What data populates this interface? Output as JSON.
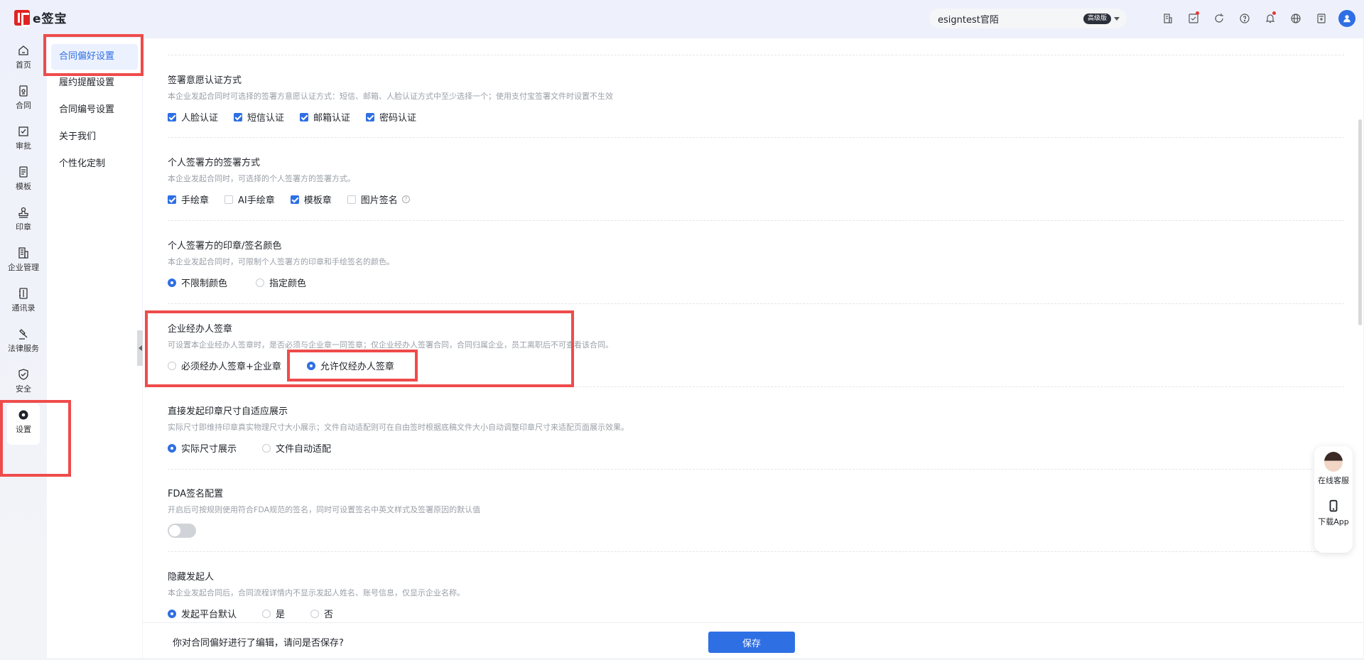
{
  "app": {
    "logo_text": "e签宝",
    "org_name": "esigntest官陌",
    "plan_badge": "高级版"
  },
  "leftnav": [
    {
      "label": "首页",
      "icon": "home-icon"
    },
    {
      "label": "合同",
      "icon": "contract-icon"
    },
    {
      "label": "审批",
      "icon": "approval-icon"
    },
    {
      "label": "模板",
      "icon": "template-icon"
    },
    {
      "label": "印章",
      "icon": "seal-icon"
    },
    {
      "label": "企业管理",
      "icon": "enterprise-icon"
    },
    {
      "label": "通讯录",
      "icon": "contacts-icon"
    },
    {
      "label": "法律服务",
      "icon": "gavel-icon"
    },
    {
      "label": "安全",
      "icon": "shield-icon"
    },
    {
      "label": "设置",
      "icon": "gear-icon",
      "active": true
    }
  ],
  "subnav": [
    {
      "label": "合同偏好设置",
      "active": true
    },
    {
      "label": "履约提醒设置"
    },
    {
      "label": "合同编号设置"
    },
    {
      "label": "关于我们"
    },
    {
      "label": "个性化定制"
    }
  ],
  "sections": {
    "auth": {
      "title": "签署意愿认证方式",
      "desc": "本企业发起合同时可选择的签署方意愿认证方式：短信、邮箱、人脸认证方式中至少选择一个；使用支付宝签署文件时设置不生效",
      "options": [
        "人脸认证",
        "短信认证",
        "邮箱认证",
        "密码认证"
      ]
    },
    "personal_sign": {
      "title": "个人签署方的签署方式",
      "desc": "本企业发起合同时，可选择的个人签署方的签署方式。",
      "options": [
        "手绘章",
        "AI手绘章",
        "模板章",
        "图片签名"
      ]
    },
    "color": {
      "title": "个人签署方的印章/签名颜色",
      "desc": "本企业发起合同时，可限制个人签署方的印章和手绘签名的颜色。",
      "options": [
        "不限制颜色",
        "指定颜色"
      ]
    },
    "agent": {
      "title": "企业经办人签章",
      "desc": "可设置本企业经办人签章时，是否必须与企业章一同签章；仅企业经办人签署合同，合同归属企业，员工离职后不可查看该合同。",
      "options": [
        "必须经办人签章+企业章",
        "允许仅经办人签章"
      ]
    },
    "size": {
      "title": "直接发起印章尺寸自适应展示",
      "desc": "实际尺寸即维持印章真实物理尺寸大小展示；文件自动适配则可在自由签时根据底稿文件大小自动调整印章尺寸来适配页面展示效果。",
      "options": [
        "实际尺寸展示",
        "文件自动适配"
      ]
    },
    "fda": {
      "title": "FDA签名配置",
      "desc": "开启后可按规则使用符合FDA规范的签名，同时可设置签名中英文样式及签署原因的默认值"
    },
    "hide": {
      "title": "隐藏发起人",
      "desc": "本企业发起合同后，合同流程详情内不显示发起人姓名、账号信息，仅显示企业名称。",
      "options": [
        "发起平台默认",
        "是",
        "否"
      ]
    }
  },
  "bottom": {
    "message": "你对合同偏好进行了编辑，请问是否保存?",
    "save_label": "保存"
  },
  "float": {
    "service_label": "在线客服",
    "app_label": "下载App"
  },
  "colors": {
    "accent": "#2f6fe4",
    "highlight": "#ef4b4b"
  }
}
